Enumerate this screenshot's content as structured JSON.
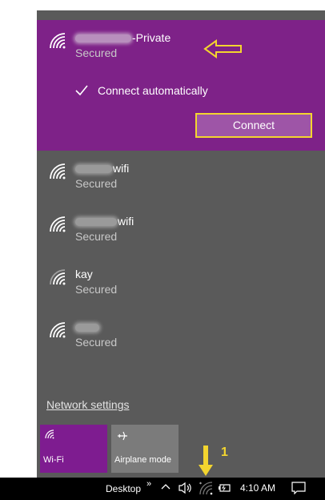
{
  "networks": [
    {
      "name_suffix": "-Private",
      "status": "Secured",
      "selected": true
    },
    {
      "name_suffix": "wifi",
      "status": "Secured"
    },
    {
      "name_suffix": "wifi",
      "status": "Secured"
    },
    {
      "name": "kay",
      "status": "Secured"
    },
    {
      "name": "",
      "status": "Secured"
    }
  ],
  "selected_network": {
    "connect_automatically_label": "Connect automatically",
    "connect_automatically_checked": true,
    "connect_button_label": "Connect"
  },
  "network_settings_link": "Network settings",
  "quick_actions": [
    {
      "label": "Wi-Fi",
      "icon": "wifi-icon",
      "active": true
    },
    {
      "label": "Airplane mode",
      "icon": "airplane-icon",
      "active": false
    }
  ],
  "taskbar": {
    "desktop_label": "Desktop",
    "chevron": "»",
    "time": "4:10 AM"
  },
  "annotation": {
    "step_number": "1"
  },
  "colors": {
    "accent": "#7e2288",
    "flyout_bg": "#5a5a5a",
    "highlight": "#f3d52f"
  }
}
